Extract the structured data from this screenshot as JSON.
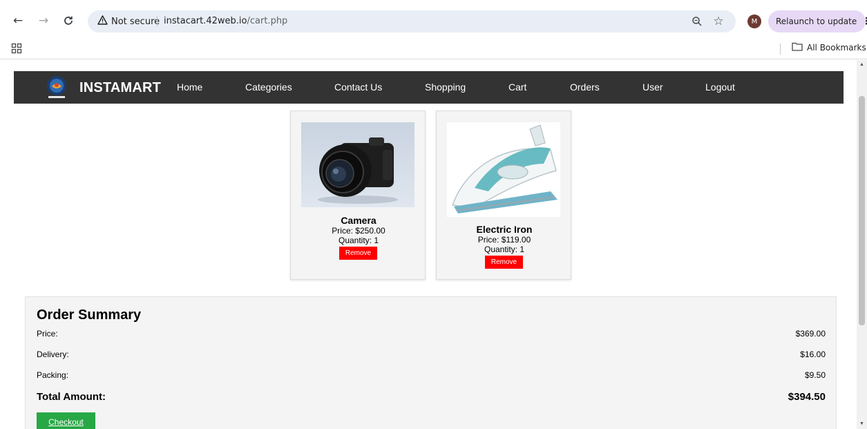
{
  "browser": {
    "security_label": "Not secure",
    "url_host": "instacart.42web.io",
    "url_path": "/cart.php",
    "relaunch_label": "Relaunch to update",
    "profile_initial": "M",
    "all_bookmarks_label": "All Bookmarks"
  },
  "site": {
    "brand": "INSTAMART",
    "nav": [
      "Home",
      "Categories",
      "Contact Us",
      "Shopping",
      "Cart",
      "Orders",
      "User",
      "Logout"
    ]
  },
  "cart": {
    "items": [
      {
        "name": "Camera",
        "price": "Price: $250.00",
        "quantity": "Quantity: 1",
        "remove_label": "Remove"
      },
      {
        "name": "Electric Iron",
        "price": "Price: $119.00",
        "quantity": "Quantity: 1",
        "remove_label": "Remove"
      }
    ]
  },
  "summary": {
    "title": "Order Summary",
    "price_label": "Price:",
    "price_value": "$369.00",
    "delivery_label": "Delivery:",
    "delivery_value": "$16.00",
    "packing_label": "Packing:",
    "packing_value": "$9.50",
    "total_label": "Total Amount:",
    "total_value": "$394.50",
    "checkout_label": "Checkout"
  },
  "colors": {
    "nav_bg": "#333333",
    "remove_button": "#ff0000",
    "checkout_button": "#28a745",
    "relaunch_chip": "#e7d9f6"
  }
}
